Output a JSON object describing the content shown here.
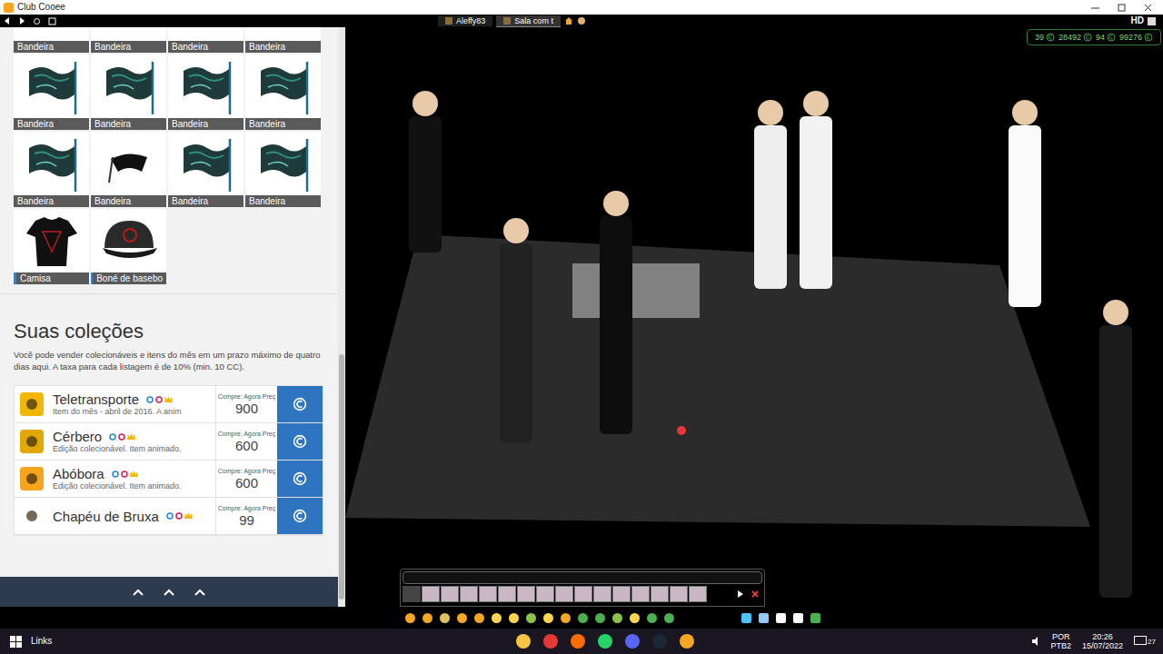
{
  "window": {
    "title": "Club Cooee"
  },
  "tabs": [
    {
      "label": "Aleffy83",
      "selected": false
    },
    {
      "label": "Sala com t",
      "selected": true
    }
  ],
  "quality": "HD",
  "inventory": [
    {
      "label": "Bandeira",
      "kind": "flag",
      "cut": true,
      "marked": false
    },
    {
      "label": "Bandeira",
      "kind": "flag",
      "cut": true,
      "marked": false
    },
    {
      "label": "Bandeira",
      "kind": "flag",
      "cut": true,
      "marked": false
    },
    {
      "label": "Bandeira",
      "kind": "flag",
      "cut": true,
      "marked": false
    },
    {
      "label": "Bandeira",
      "kind": "flag",
      "cut": false,
      "marked": false
    },
    {
      "label": "Bandeira",
      "kind": "flag",
      "cut": false,
      "marked": false
    },
    {
      "label": "Bandeira",
      "kind": "flag",
      "cut": false,
      "marked": false
    },
    {
      "label": "Bandeira",
      "kind": "flag",
      "cut": false,
      "marked": false
    },
    {
      "label": "Bandeira",
      "kind": "flag",
      "cut": false,
      "marked": false
    },
    {
      "label": "Bandeira",
      "kind": "pennant",
      "cut": false,
      "marked": false
    },
    {
      "label": "Bandeira",
      "kind": "flag",
      "cut": false,
      "marked": false
    },
    {
      "label": "Bandeira",
      "kind": "flag",
      "cut": false,
      "marked": false
    },
    {
      "label": "Camisa",
      "kind": "shirt",
      "cut": false,
      "marked": true
    },
    {
      "label": "Boné de basebo",
      "kind": "cap",
      "cut": false,
      "marked": true
    }
  ],
  "collections": {
    "title": "Suas coleções",
    "description": "Você pode vender colecionáveis e itens do mês em um prazo máximo de quatro dias aqui. A taxa para cada listagem é de 10% (min. 10 CC).",
    "items": [
      {
        "name": "Teletransporte",
        "subtitle": "Item do mês - abril de 2016. A anim",
        "price_label": "Compre: Agora Preç",
        "price": "900",
        "color": "#f2b705"
      },
      {
        "name": "Cérbero",
        "subtitle": "Edição colecionável. Item animado.",
        "price_label": "Compre: Agora Preç",
        "price": "600",
        "color": "#e0a800"
      },
      {
        "name": "Abóbora",
        "subtitle": "Edição colecionável. Item animado.",
        "price_label": "Compre: Agora Preç",
        "price": "600",
        "color": "#f7a31c"
      },
      {
        "name": "Chapéu de Bruxa",
        "subtitle": "",
        "price_label": "Compre: Agora Preç",
        "price": "99",
        "color": "#ffffff"
      }
    ]
  },
  "stats": [
    "39",
    "28492",
    "94",
    "99276"
  ],
  "taskbar": {
    "search": "Links",
    "language": "POR",
    "layout": "PTB2",
    "time": "20:26",
    "date": "15/07/2022",
    "notifications": "27"
  }
}
